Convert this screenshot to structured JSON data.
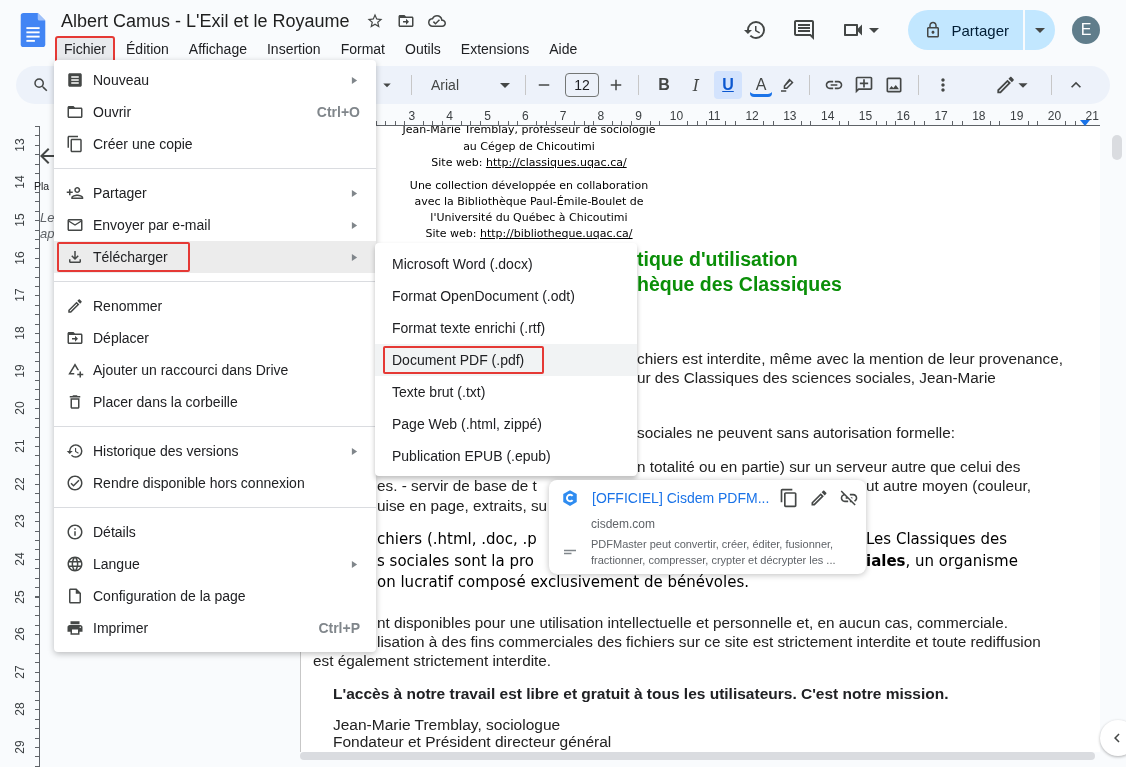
{
  "document_title": "Albert Camus - L'Exil et le Royaume",
  "menu_bar": [
    {
      "label": "Fichier",
      "selected": true
    },
    {
      "label": "Édition",
      "selected": false
    },
    {
      "label": "Affichage",
      "selected": false
    },
    {
      "label": "Insertion",
      "selected": false
    },
    {
      "label": "Format",
      "selected": false
    },
    {
      "label": "Outils",
      "selected": false
    },
    {
      "label": "Extensions",
      "selected": false
    },
    {
      "label": "Aide",
      "selected": false
    }
  ],
  "share_button": {
    "label": "Partager"
  },
  "account": {
    "initial": "E"
  },
  "toolbar": {
    "font": "Arial",
    "font_size": "12",
    "format_buttons": [
      {
        "label": "B",
        "selected": false
      },
      {
        "label": "I",
        "selected": false
      },
      {
        "label": "U",
        "selected": true
      },
      {
        "label": "A",
        "selected": false
      }
    ]
  },
  "ruler": {
    "horizontal": [
      "3",
      "4",
      "5",
      "6",
      "7",
      "8",
      "9",
      "10",
      "11",
      "12",
      "13",
      "14",
      "15",
      "16",
      "17",
      "18",
      "19",
      "20",
      "21"
    ],
    "vertical": [
      "13",
      "14",
      "15",
      "16",
      "17",
      "18",
      "19",
      "20",
      "21",
      "22",
      "23",
      "24",
      "25",
      "26",
      "27",
      "28",
      "29"
    ]
  },
  "outline": [
    {
      "text": "Pla",
      "kind": "heading"
    },
    {
      "text": "Le",
      "kind": "note"
    },
    {
      "text": "ap",
      "kind": "note"
    }
  ],
  "document": {
    "paragraphs": [
      {
        "kind": "comic-center",
        "lines": [
          {
            "text": "Jean-Marie Tremblay, professeur de sociologie"
          },
          {
            "text": "au Cégep de Chicoutimi"
          },
          {
            "text": "Site web: ",
            "link": "http://classiques.uqac.ca/"
          }
        ]
      },
      {
        "kind": "comic-center",
        "lines": [
          {
            "text": "Une collection développée en collaboration"
          },
          {
            "text": "avec la Bibliothèque Paul-Émile-Boulet de"
          },
          {
            "text": "l'Université du Québec à Chicoutimi"
          },
          {
            "text": "Site web: ",
            "link": "http://bibliotheque.uqac.ca/"
          }
        ]
      },
      {
        "kind": "heading",
        "lines": [
          {
            "after_submenu": "tique d'utilisation"
          },
          {
            "after_submenu": "hèque des Classiques"
          }
        ]
      },
      {
        "kind": "body",
        "lines": [
          {
            "after_submenu": "chiers est interdite, même avec la mention de leur provenance,"
          },
          {
            "after_submenu": "ur des Classiques des sciences sociales, Jean-Marie"
          }
        ]
      },
      {
        "kind": "body",
        "lines": [
          {
            "after_submenu": "sociales ne peuvent sans autorisation formelle:"
          }
        ]
      },
      {
        "kind": "body",
        "lines": [
          {
            "after_submenu": "n totalité ou en partie) sur un serveur autre que celui des"
          },
          {
            "after_menu": "es. - servir de base de t",
            "after_popup": "ut autre moyen (couleur,"
          },
          {
            "after_menu": "uise en page, extraits, su"
          }
        ]
      },
      {
        "kind": "comic-body",
        "lines": [
          {
            "after_menu": "chiers (.html, .doc, .p",
            "after_popup": "Les Classiques des"
          },
          {
            "after_menu": "s sociales sont la pro",
            "after_popup": "**iales**, un organisme"
          },
          {
            "after_menu": "on lucratif composé exclusivement de bénévoles."
          }
        ]
      },
      {
        "kind": "body",
        "lines": [
          {
            "after_menu": "nt disponibles pour une utilisation intellectuelle et personnelle et, en aucun cas, commerciale."
          },
          {
            "after_menu": "lisation à des fins commerciales des fichiers sur ce site est strictement interdite et toute rediffusion"
          },
          {
            "text": "est également strictement interdite."
          }
        ]
      },
      {
        "kind": "bold-indented",
        "lines": [
          {
            "text": "L'accès à notre travail est libre et gratuit à tous les utilisateurs. C'est notre mission."
          }
        ]
      },
      {
        "kind": "indented",
        "lines": [
          {
            "text": "Jean-Marie Tremblay, sociologue"
          },
          {
            "text": "Fondateur et Président directeur général"
          }
        ]
      }
    ]
  },
  "file_menu": {
    "groups": [
      [
        {
          "label": "Nouveau",
          "has_submenu": true,
          "selected": false
        },
        {
          "label": "Ouvrir",
          "shortcut": "Ctrl+O",
          "has_submenu": false,
          "selected": false
        },
        {
          "label": "Créer une copie",
          "has_submenu": false,
          "selected": false
        }
      ],
      [
        {
          "label": "Partager",
          "has_submenu": true,
          "selected": false
        },
        {
          "label": "Envoyer par e-mail",
          "has_submenu": true,
          "selected": false
        },
        {
          "label": "Télécharger",
          "has_submenu": true,
          "selected": true
        }
      ],
      [
        {
          "label": "Renommer",
          "has_submenu": false,
          "selected": false
        },
        {
          "label": "Déplacer",
          "has_submenu": false,
          "selected": false
        },
        {
          "label": "Ajouter un raccourci dans Drive",
          "has_submenu": false,
          "selected": false
        },
        {
          "label": "Placer dans la corbeille",
          "has_submenu": false,
          "selected": false
        }
      ],
      [
        {
          "label": "Historique des versions",
          "has_submenu": true,
          "selected": false
        },
        {
          "label": "Rendre disponible hors connexion",
          "has_submenu": false,
          "selected": false
        }
      ],
      [
        {
          "label": "Détails",
          "has_submenu": false,
          "selected": false
        },
        {
          "label": "Langue",
          "has_submenu": true,
          "selected": false
        },
        {
          "label": "Configuration de la page",
          "has_submenu": false,
          "selected": false
        },
        {
          "label": "Imprimer",
          "shortcut": "Ctrl+P",
          "has_submenu": false,
          "selected": false
        }
      ]
    ]
  },
  "download_submenu": [
    {
      "label": "Microsoft Word (.docx)",
      "selected": false
    },
    {
      "label": "Format OpenDocument (.odt)",
      "selected": false
    },
    {
      "label": "Format texte enrichi (.rtf)",
      "selected": false
    },
    {
      "label": "Document PDF (.pdf)",
      "selected": true
    },
    {
      "label": "Texte brut (.txt)",
      "selected": false
    },
    {
      "label": "Page Web (.html, zippé)",
      "selected": false
    },
    {
      "label": "Publication EPUB (.epub)",
      "selected": false
    }
  ],
  "link_preview": {
    "title": "[OFFICIEL] Cisdem PDFM...",
    "domain": "cisdem.com",
    "description": "PDFMaster peut convertir, créer, éditer, fusionner, fractionner, compresser, crypter et décrypter les ..."
  }
}
